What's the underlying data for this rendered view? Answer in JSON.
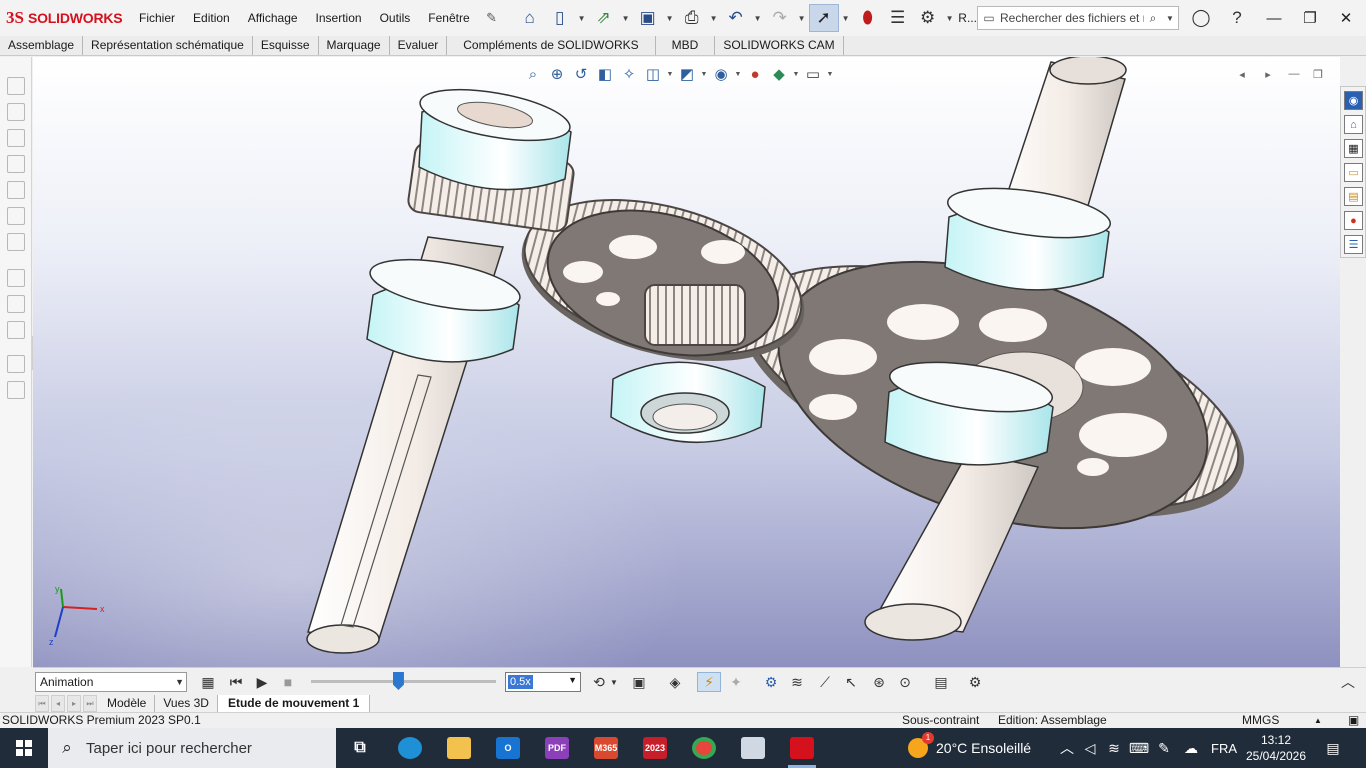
{
  "app": {
    "logo_ds": "3S",
    "logo_name": "SOLIDWORKS"
  },
  "menu": [
    "Fichier",
    "Edition",
    "Affichage",
    "Insertion",
    "Outils",
    "Fenêtre"
  ],
  "quick_access": {
    "rebuild_label": "R...",
    "icons": [
      "home-icon",
      "new-document-icon",
      "open-icon",
      "save-icon",
      "print-icon",
      "undo-icon",
      "redo-icon",
      "select-icon",
      "traffic-light-icon",
      "file-properties-icon",
      "options-icon"
    ]
  },
  "search": {
    "placeholder": "Rechercher des fichiers et m"
  },
  "ribbon_tabs": [
    "Assemblage",
    "Représentation schématique",
    "Esquisse",
    "Marquage",
    "Evaluer",
    "Compléments de SOLIDWORKS",
    "MBD",
    "SOLIDWORKS CAM"
  ],
  "motion": {
    "study_type": "Animation",
    "speed": "0.5x",
    "timeline_position": 0.47
  },
  "bottom_tabs": {
    "model": "Modèle",
    "views3d": "Vues 3D",
    "study": "Etude de mouvement 1"
  },
  "status": {
    "product": "SOLIDWORKS Premium 2023 SP0.1",
    "constraint": "Sous-contraint",
    "edit": "Edition: Assemblage",
    "units": "MMGS"
  },
  "taskbar": {
    "search_placeholder": "Taper ici pour rechercher",
    "weather": "20°C  Ensoleillé",
    "weather_badge": "1",
    "language": "FRA",
    "time": "13:12",
    "date": "25/04/2026",
    "apps": [
      {
        "name": "task-view",
        "label": ""
      },
      {
        "name": "edge",
        "label": ""
      },
      {
        "name": "file-explorer",
        "label": ""
      },
      {
        "name": "outlook",
        "label": ""
      },
      {
        "name": "pdf-app",
        "label": "PDF"
      },
      {
        "name": "microsoft365",
        "label": "M365"
      },
      {
        "name": "solidworks-2023",
        "label": "2023"
      },
      {
        "name": "chrome",
        "label": ""
      },
      {
        "name": "photos",
        "label": ""
      },
      {
        "name": "solidworks-active",
        "label": ""
      }
    ]
  },
  "triad": {
    "x": "x",
    "y": "y",
    "z": "z"
  },
  "colors": {
    "brand": "#d5111e",
    "bearing": "#c5f4f6",
    "gear": "#f2ece6",
    "taskbar": "#202c3a"
  }
}
